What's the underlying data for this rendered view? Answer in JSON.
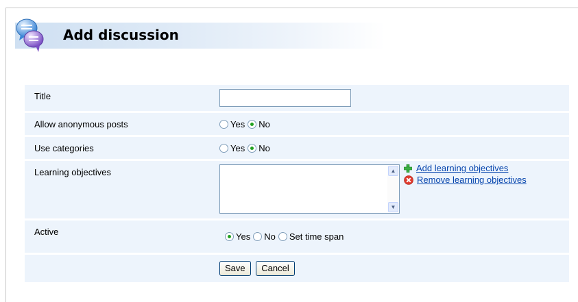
{
  "header": {
    "title": "Add discussion",
    "icon": "discussion-bubbles-icon"
  },
  "form": {
    "title": {
      "label": "Title",
      "value": ""
    },
    "anonymous": {
      "label": "Allow anonymous posts",
      "yes": "Yes",
      "no": "No",
      "selected": "No"
    },
    "categories": {
      "label": "Use categories",
      "yes": "Yes",
      "no": "No",
      "selected": "No"
    },
    "learning_objectives": {
      "label": "Learning objectives",
      "add_link": "Add learning objectives",
      "remove_link": "Remove learning objectives"
    },
    "active": {
      "label": "Active",
      "yes": "Yes",
      "no": "No",
      "timespan": "Set time span",
      "selected": "Yes"
    },
    "buttons": {
      "save": "Save",
      "cancel": "Cancel"
    }
  },
  "colors": {
    "row_bg": "#edf4fc",
    "link": "#0645ad",
    "radio_dot": "#21a121",
    "add_icon": "#3cb043",
    "remove_icon": "#e03a2e"
  }
}
